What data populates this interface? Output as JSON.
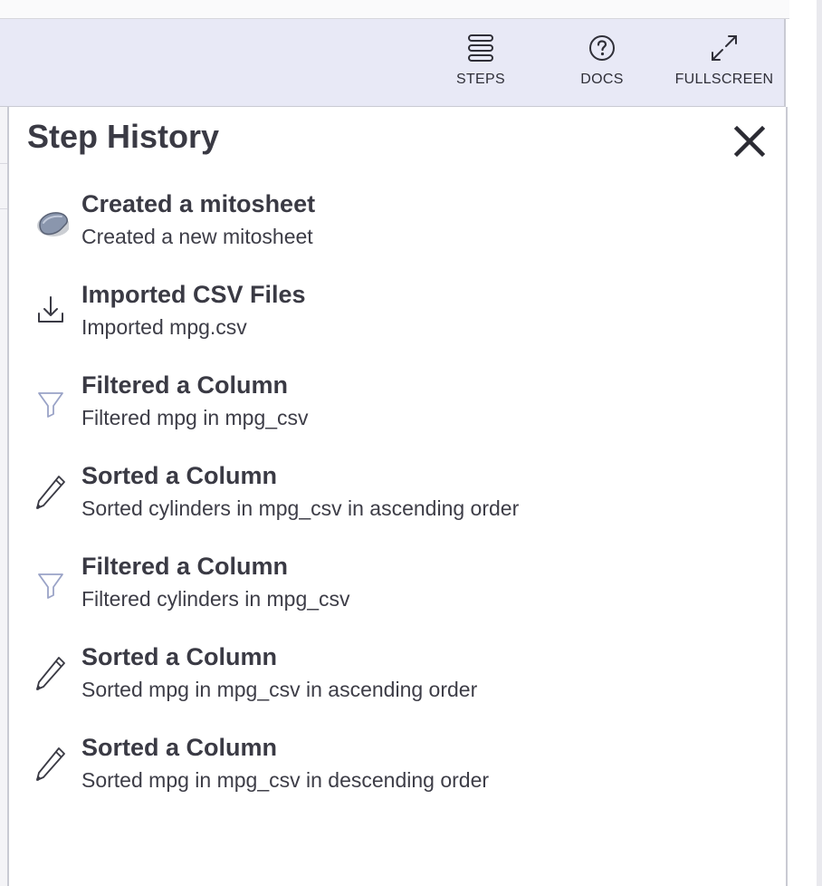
{
  "toolbar": {
    "steps_label": "STEPS",
    "docs_label": "DOCS",
    "fullscreen_label": "FULLSCREEN"
  },
  "panel": {
    "title": "Step History",
    "close_icon": "close-icon"
  },
  "steps": [
    {
      "title": "Created a mitosheet",
      "description": "Created a new mitosheet",
      "icon": "mito-logo-icon"
    },
    {
      "title": "Imported CSV Files",
      "description": "Imported mpg.csv",
      "icon": "import-icon"
    },
    {
      "title": "Filtered a Column",
      "description": "Filtered mpg in mpg_csv",
      "icon": "filter-icon"
    },
    {
      "title": "Sorted a Column",
      "description": "Sorted cylinders in mpg_csv in ascending order",
      "icon": "pencil-icon"
    },
    {
      "title": "Filtered a Column",
      "description": "Filtered cylinders in mpg_csv",
      "icon": "filter-icon"
    },
    {
      "title": "Sorted a Column",
      "description": "Sorted mpg in mpg_csv in ascending order",
      "icon": "pencil-icon"
    },
    {
      "title": "Sorted a Column",
      "description": "Sorted mpg in mpg_csv in descending order",
      "icon": "pencil-icon"
    }
  ],
  "colors": {
    "toolbar_bg": "#e8e9f6",
    "filter_icon": "#9aa3c7",
    "text": "#3a3a44"
  }
}
